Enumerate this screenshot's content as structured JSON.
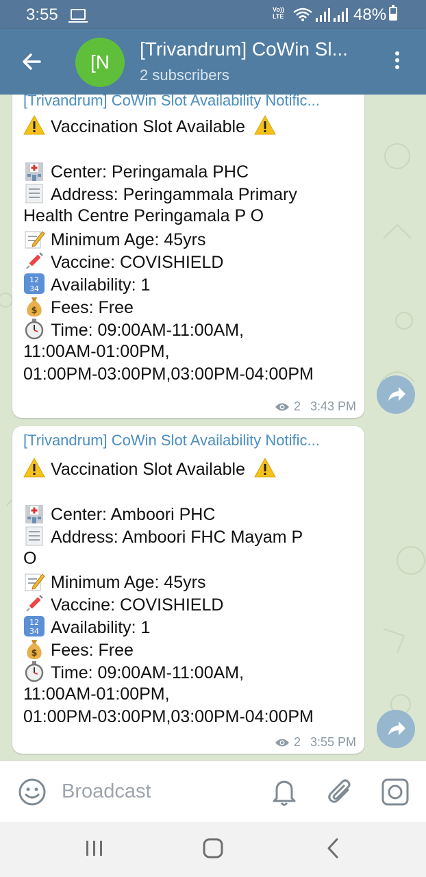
{
  "status_bar": {
    "time": "3:55",
    "volte_line1": "Vo))",
    "volte_line2": "LTE",
    "battery": "48%"
  },
  "header": {
    "avatar_letter": "[N",
    "title": "[Trivandrum] CoWin Sl...",
    "subtitle": "2 subscribers"
  },
  "messages": [
    {
      "sender": "[Trivandrum] CoWin Slot Availability Notific...",
      "heading": "Vaccination Slot Available",
      "center": "Center: Peringamala PHC",
      "address_line1": "Address: Peringammala Primary",
      "address_line2": "Health Centre  Peringamala P O",
      "min_age": "Minimum Age: 45yrs",
      "vaccine": "Vaccine: COVISHIELD",
      "availability": "Availability: 1",
      "fees": "Fees: Free",
      "time_line1": "Time: 09:00AM-11:00AM,",
      "time_line2": "11:00AM-01:00PM,",
      "time_line3": "01:00PM-03:00PM,03:00PM-04:00PM",
      "views": "2",
      "timestamp": "3:43 PM"
    },
    {
      "sender": "[Trivandrum] CoWin Slot Availability Notific...",
      "heading": "Vaccination Slot Available",
      "center": "Center: Amboori PHC",
      "address_line1": "Address: Amboori FHC Mayam P",
      "address_line2": "O",
      "min_age": "Minimum Age: 45yrs",
      "vaccine": "Vaccine: COVISHIELD",
      "availability": "Availability: 1",
      "fees": "Fees: Free",
      "time_line1": "Time: 09:00AM-11:00AM,",
      "time_line2": "11:00AM-01:00PM,",
      "time_line3": "01:00PM-03:00PM,03:00PM-04:00PM",
      "views": "2",
      "timestamp": "3:55 PM"
    }
  ],
  "input_bar": {
    "placeholder": "Broadcast"
  },
  "icons": {
    "status": [
      "screen-mirror-icon",
      "wifi-icon",
      "signal-icon",
      "battery-icon"
    ],
    "header": [
      "back-arrow-icon",
      "more-vert-icon"
    ],
    "message": [
      "warning-icon",
      "hospital-icon",
      "document-icon",
      "memo-icon",
      "syringe-icon",
      "numbers-icon",
      "money-bag-icon",
      "stopwatch-icon",
      "eye-icon",
      "share-icon"
    ],
    "input_bar": [
      "smile-icon",
      "bell-icon",
      "paperclip-icon",
      "camera-icon"
    ],
    "nav": [
      "recents-icon",
      "home-icon",
      "back-icon"
    ]
  },
  "colors": {
    "header": "#517da2",
    "status_bar": "#557799",
    "avatar": "#5fbf3b",
    "sender_name": "#4a8ec0",
    "share_button": "#97b7cf",
    "chat_background": "#dbe6d1"
  }
}
